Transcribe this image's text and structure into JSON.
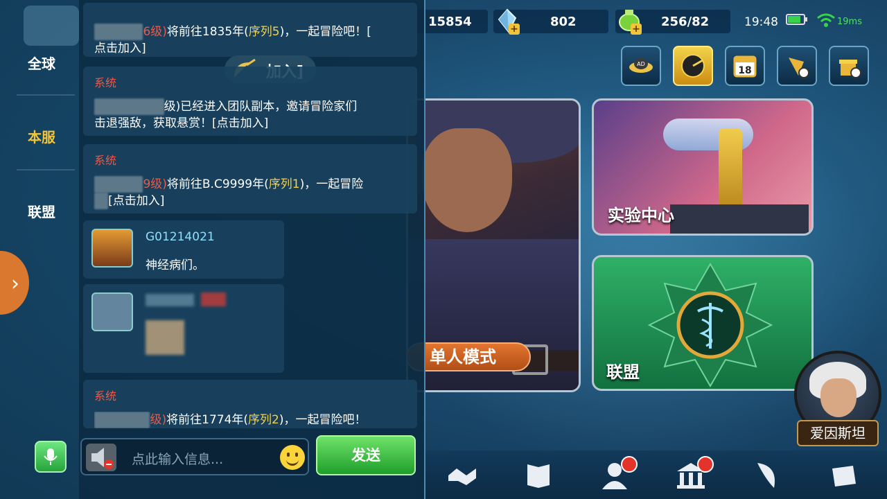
{
  "resources": {
    "gold": "15854",
    "gems": "802",
    "energy": "256/82"
  },
  "status": {
    "time": "19:48",
    "ping": "19ms",
    "battery_level": 0.75
  },
  "top_icons": [
    "ad-icon",
    "radar-icon",
    "calendar-18-icon",
    "kite-timer-icon",
    "gift-timer-icon"
  ],
  "top_icon_labels": {
    "ad": "AD",
    "calendar": "18"
  },
  "cards": {
    "single_mode": "单人模式",
    "lab": "实验中心",
    "alliance": "联盟"
  },
  "npc": {
    "name": "爱因斯坦"
  },
  "chat": {
    "tabs": {
      "global": "全球",
      "server": "本服",
      "alliance": "联盟"
    },
    "active_tab": "server",
    "join_floater": "加入]",
    "messages": [
      {
        "label": "",
        "parts": [
          "6级)",
          "将前往1835年(",
          "序列5",
          ")，一起冒险吧！[",
          "点击加入]"
        ]
      },
      {
        "label": "系统",
        "parts": [
          "级)已经进入团队副本，邀请冒险家们",
          "击退强敌，获取悬赏！[点击加入]"
        ]
      },
      {
        "label": "系统",
        "parts": [
          "9级)",
          "将前往B.C9999年(",
          "序列1",
          ")，一起冒险",
          "[点击加入]"
        ]
      },
      {
        "label": "系统",
        "parts": [
          "级)",
          "将前往1774年(",
          "序列2",
          ")，一起冒险吧！"
        ]
      }
    ],
    "user_messages": [
      {
        "name": "G01214021",
        "text": "神经病们。"
      }
    ],
    "input_placeholder": "点此输入信息...",
    "send_label": "发送"
  }
}
